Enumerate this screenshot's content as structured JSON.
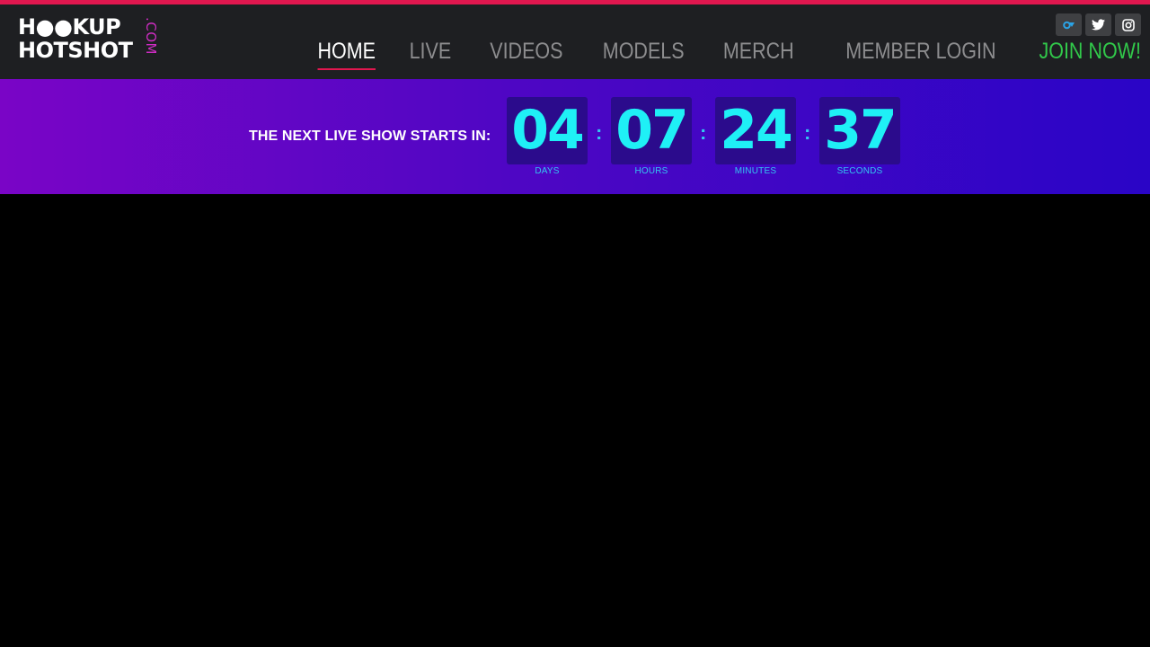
{
  "logo": {
    "line1": "H●●KUP",
    "line2": "HOTSHOT",
    "dotcom": ".COM",
    "alt": "HOOKUP HOTSHOT .COM"
  },
  "socials": [
    {
      "icon": "onlyfans-icon",
      "label": ""
    },
    {
      "icon": "twitter-icon",
      "label": ""
    },
    {
      "icon": "instagram-icon",
      "label": ""
    }
  ],
  "nav": {
    "home": "HOME",
    "live": "LIVE",
    "videos": "VIDEOS",
    "models": "MODELS",
    "merch": "MERCH",
    "login": "MEMBER LOGIN",
    "join": "JOIN NOW!"
  },
  "countdown": {
    "label": "THE NEXT LIVE SHOW STARTS IN:",
    "days": "04",
    "days_label": "DAYS",
    "hours": "07",
    "hours_label": "HOURS",
    "minutes": "24",
    "minutes_label": "MINUTES",
    "seconds": "37",
    "seconds_label": "SECONDS",
    "separator": ":"
  },
  "colors": {
    "accent": "#e0174f",
    "join": "#31c84a",
    "digits": "#1ff0f6",
    "header_bg": "#1e1f22"
  }
}
